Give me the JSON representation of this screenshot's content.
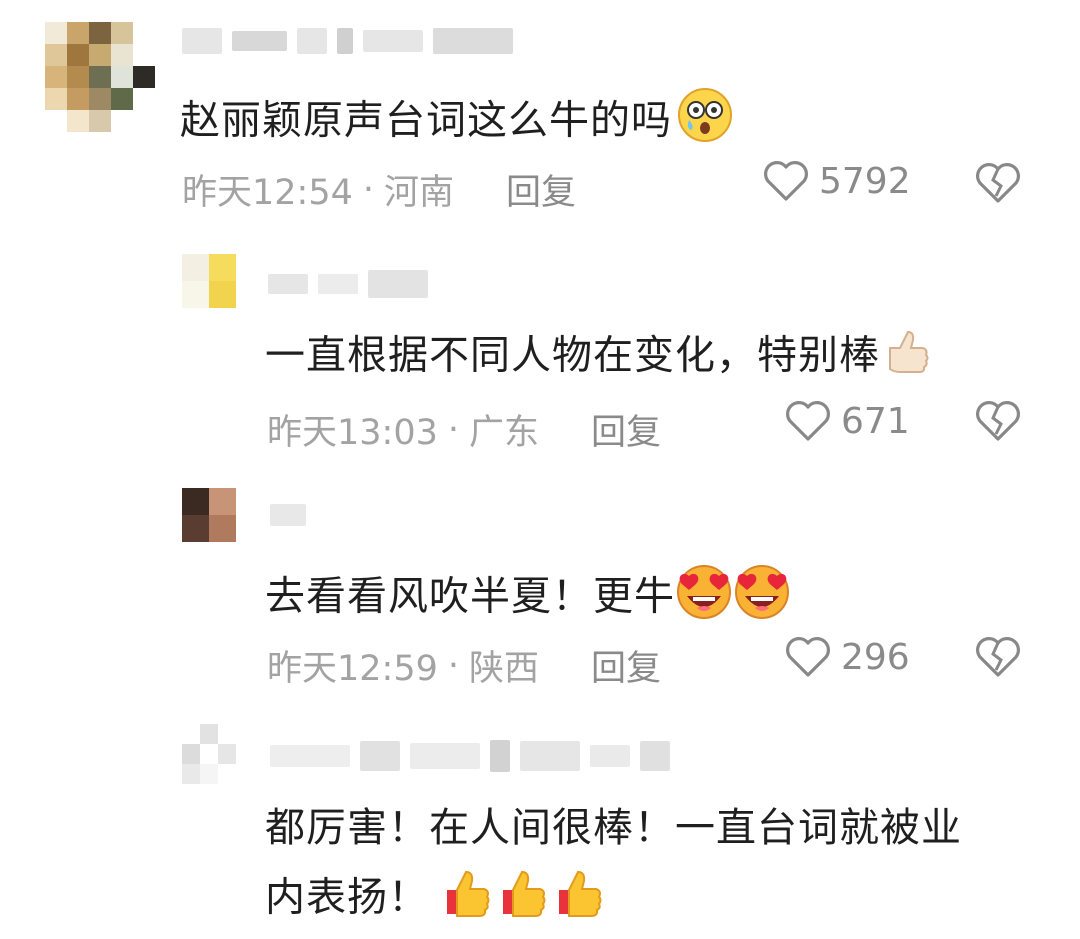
{
  "comments": [
    {
      "text": "赵丽颖原声台词这么牛的吗",
      "emoji": [
        "cry-surprised-face-emoji"
      ],
      "time": "昨天12:54",
      "location": "河南",
      "reply_label": "回复",
      "likes": "5792"
    },
    {
      "text": "一直根据不同人物在变化，特别棒",
      "emoji": [
        "thumbs-up-emoji"
      ],
      "time": "昨天13:03",
      "location": "广东",
      "reply_label": "回复",
      "likes": "671"
    },
    {
      "text": "去看看风吹半夏！更牛",
      "emoji": [
        "heart-eyes-face-emoji",
        "heart-eyes-face-emoji"
      ],
      "time": "昨天12:59",
      "location": "陕西",
      "reply_label": "回复",
      "likes": "296"
    },
    {
      "text_line1": "都厉害！在人间很棒！一直台词就被业",
      "text_line2": "内表扬！",
      "emoji": [
        "thumbs-up-emoji",
        "thumbs-up-emoji",
        "thumbs-up-emoji"
      ]
    }
  ],
  "separator": "·",
  "icons": {
    "like": "heart-outline-icon",
    "dislike": "broken-heart-icon"
  },
  "colors": {
    "text": "#1f1f1f",
    "meta": "#a3a3a3",
    "reply": "#8a8a8a"
  }
}
